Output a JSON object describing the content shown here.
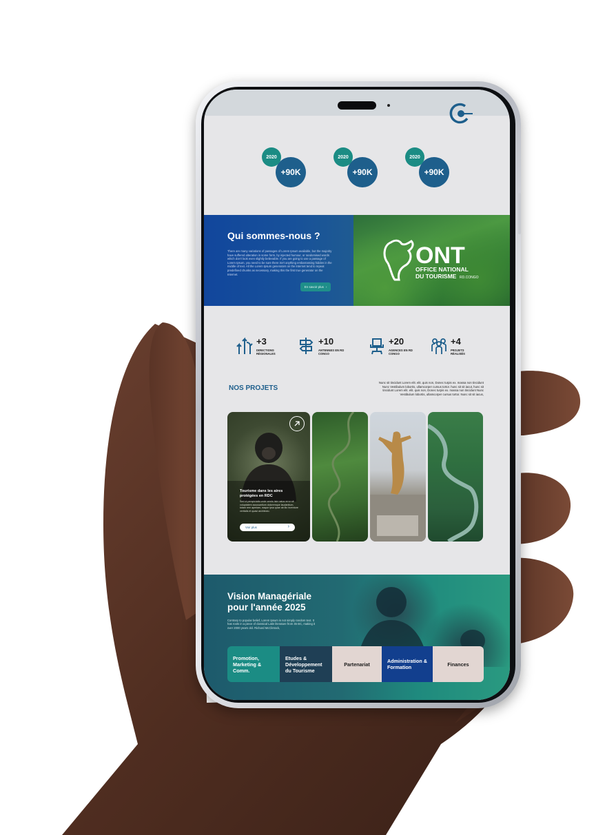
{
  "stats": [
    {
      "year": "2020",
      "value": "+90K"
    },
    {
      "year": "2020",
      "value": "+90K"
    },
    {
      "year": "2020",
      "value": "+90K"
    }
  ],
  "about": {
    "title": "Qui sommes-nous ?",
    "text": "There are many variations of passages of Lorem Ipsum available, but the majority have suffered alteration in some form, by injected humour, or randomised words which don't look even slightly believable. If you are going to use a passage of Lorem Ipsum, you need to be sure there isn't anything embarrassing hidden in the middle of text. All the Lorem Ipsum generators on the Internet tend to repeat predefined chunks as necessary, making this the first true generator on the Internet.",
    "button": "En savoir plus",
    "logo": {
      "letters": "ONT",
      "line1": "OFFICE NATIONAL",
      "line2": "DU TOURISME",
      "country": "RD.CONGO"
    }
  },
  "counts": [
    {
      "icon": "directions-icon",
      "value": "+3",
      "label": "DIRECTIONS RÉGIONALES"
    },
    {
      "icon": "signpost-icon",
      "value": "+10",
      "label": "ANTENNES EN RD CONGO"
    },
    {
      "icon": "office-chair-icon",
      "value": "+20",
      "label": "AGENCES EN RD CONGO"
    },
    {
      "icon": "people-icon",
      "value": "+4",
      "label": "PROJETS RÉALISÉS"
    }
  ],
  "projects": {
    "title": "NOS PROJETS",
    "description": "Nunc sit tincidunt Lorem elit. elit. quis non, Donec turpis ex. massa non tincidunt Nunc Vestibulum lobortis, ullamcorper cursus tortor. hunc sit sit iacut, hunc sit tincidunt Lorem elit. elit. quis non, Donec turpis ex. massa non tincidunt Nunc Vestibulum lobortis, ullamcorper cursus tortor. Nunc sit sit iacus,",
    "featured": {
      "title": "Tourisme dans les aires protégées en RDC",
      "text": "Sed ut perspiciatis unde omnis iste natus error sit voluptatem accusantium doloremque laudantium, totam rem aperiam, eaque ipsa quae ab illo inventore veritatis et quasi architecto.",
      "button": "Voir plus"
    }
  },
  "vision": {
    "title": "Vision Managériale pour l'année 2025",
    "text": "Contrary to popular belief, Lorem Ipsum is not simply random text. It has roots in a piece of classical Latin literature from 45 BC, making it over 2000 years old. Richard McClintock,",
    "tabs": [
      {
        "label": "Promotion, Marketing & Comm.",
        "bg": "#1b8c84",
        "color": "#ffffff"
      },
      {
        "label": "Etudes & Développement du Tourisme",
        "bg": "#1f3f55",
        "color": "#ffffff"
      },
      {
        "label": "Partenariat",
        "bg": "#e2d6d2",
        "color": "#1a1a1a"
      },
      {
        "label": "Administration & Formation",
        "bg": "#123f8e",
        "color": "#ffffff"
      },
      {
        "label": "Finances",
        "bg": "#e2d6d2",
        "color": "#1a1a1a"
      }
    ]
  },
  "colors": {
    "teal": "#1b8c84",
    "navy": "#1e5f8c",
    "blue": "#11469c"
  }
}
